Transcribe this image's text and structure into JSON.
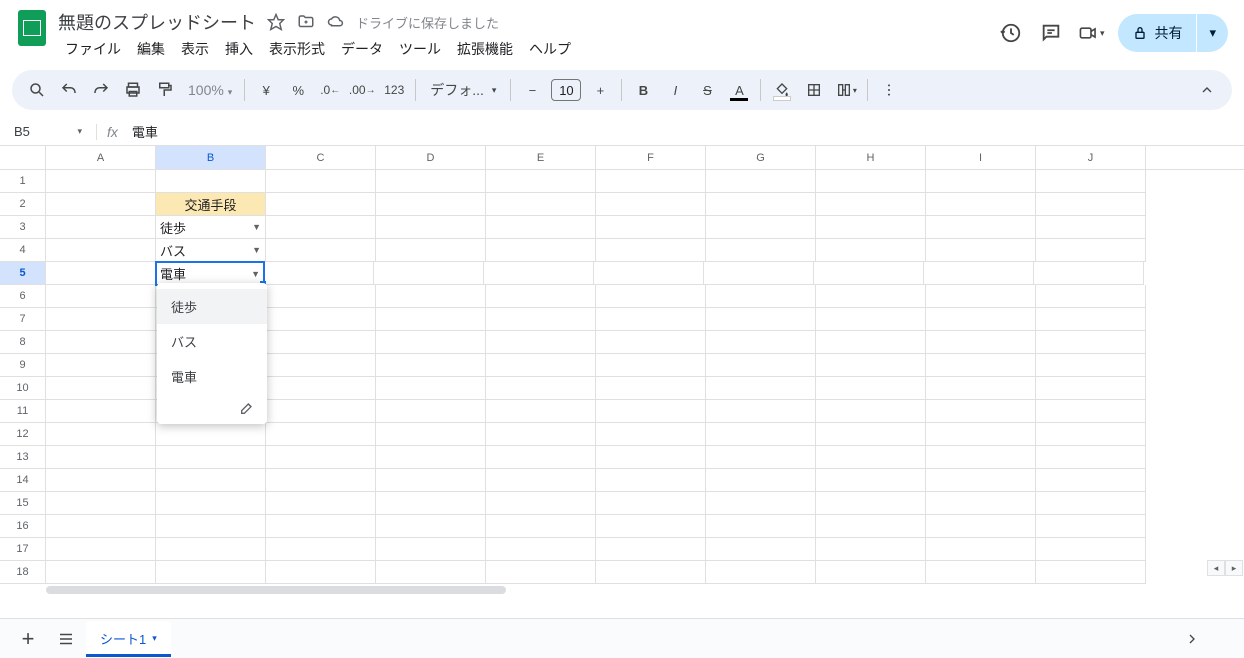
{
  "header": {
    "doc_title": "無題のスプレッドシート",
    "save_status": "ドライブに保存しました",
    "share_label": "共有"
  },
  "menu": {
    "file": "ファイル",
    "edit": "編集",
    "view": "表示",
    "insert": "挿入",
    "format": "表示形式",
    "data": "データ",
    "tools": "ツール",
    "extensions": "拡張機能",
    "help": "ヘルプ"
  },
  "toolbar": {
    "zoom": "100%",
    "currency": "¥",
    "percent": "%",
    "format_num": "123",
    "font": "デフォ...",
    "font_size": "10"
  },
  "formula_bar": {
    "cell_ref": "B5",
    "fx": "fx",
    "value": "電車"
  },
  "columns": [
    "A",
    "B",
    "C",
    "D",
    "E",
    "F",
    "G",
    "H",
    "I",
    "J"
  ],
  "row_count": 18,
  "active_row": 5,
  "active_col": "B",
  "cells": {
    "B2": {
      "value": "交通手段",
      "type": "header"
    },
    "B3": {
      "value": "徒歩",
      "type": "dropdown"
    },
    "B4": {
      "value": "バス",
      "type": "dropdown"
    },
    "B5": {
      "value": "電車",
      "type": "dropdown-active"
    }
  },
  "dropdown": {
    "options": [
      "徒歩",
      "バス",
      "電車"
    ],
    "hovered_index": 0
  },
  "tabs": {
    "sheet1": "シート1"
  }
}
